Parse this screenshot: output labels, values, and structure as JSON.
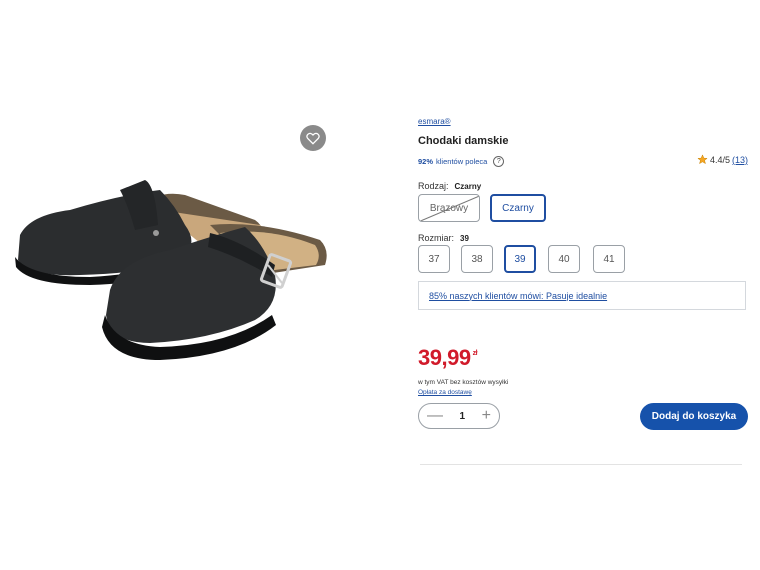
{
  "product": {
    "brand": "esmara®",
    "title": "Chodaki damskie",
    "recommend_percent": "92%",
    "recommend_text": "klientów poleca",
    "rating_value": "4.4/5",
    "rating_count": "(13)",
    "star_color": "#f5a623"
  },
  "variants": {
    "label": "Rodzaj:",
    "selected_value": "Czarny",
    "options": [
      "Brązowy",
      "Czarny"
    ]
  },
  "sizes": {
    "label": "Rozmiar:",
    "selected_value": "39",
    "options": [
      "37",
      "38",
      "39",
      "40",
      "41"
    ]
  },
  "fit_feedback": "85% naszych klientów mówi: Pasuje idealnie",
  "pricing": {
    "price": "39,99",
    "currency": "zł",
    "vat_note": "w tym VAT bez kosztów wysyłki",
    "shipping_link": "Opłata za dostawę"
  },
  "cart": {
    "quantity": "1",
    "minus_symbol": "—",
    "plus_symbol": "+",
    "add_to_cart_label": "Dodaj do koszyka"
  },
  "colors": {
    "accent_blue": "#1f4ea1",
    "price_red": "#d11a2a",
    "cart_button": "#1652ab"
  }
}
